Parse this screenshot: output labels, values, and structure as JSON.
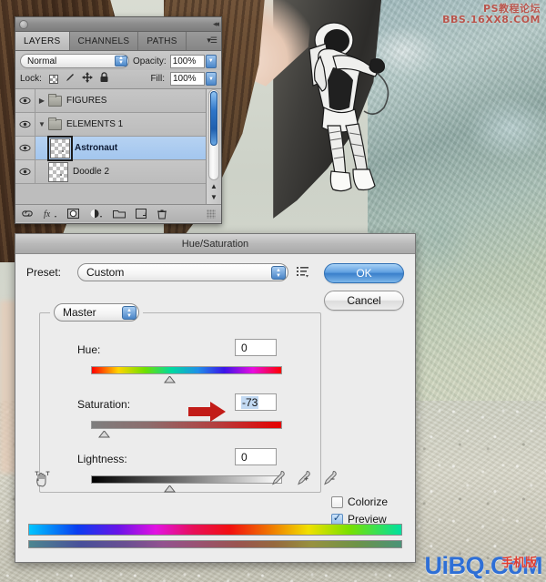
{
  "app": {
    "watermark_top_line1": "PS教程论坛",
    "watermark_top_line2": "BBS.16XX8.COM",
    "watermark_bottom": "UiBQ.CoM",
    "watermark_bottom_cn": "手机版"
  },
  "layers_panel": {
    "tabs": [
      {
        "label": "LAYERS",
        "active": true
      },
      {
        "label": "CHANNELS",
        "active": false
      },
      {
        "label": "PATHS",
        "active": false
      }
    ],
    "blend_mode": "Normal",
    "opacity_label": "Opacity:",
    "opacity_value": "100%",
    "lock_label": "Lock:",
    "fill_label": "Fill:",
    "fill_value": "100%",
    "layers": [
      {
        "name": "FIGURES",
        "type": "group",
        "expanded": false,
        "visible": true,
        "selected": false
      },
      {
        "name": "ELEMENTS 1",
        "type": "group",
        "expanded": true,
        "visible": true,
        "selected": false
      },
      {
        "name": "Astronaut",
        "type": "layer",
        "visible": true,
        "selected": true
      },
      {
        "name": "Doodle 2",
        "type": "layer",
        "visible": true,
        "selected": false
      }
    ],
    "footer_icons": [
      "link-layers-icon",
      "fx-icon",
      "layer-mask-icon",
      "adjustment-layer-icon",
      "new-group-icon",
      "new-layer-icon",
      "delete-layer-icon"
    ]
  },
  "dialog": {
    "title": "Hue/Saturation",
    "preset_label": "Preset:",
    "preset_value": "Custom",
    "preset_menu_icon": "preset-options-icon",
    "ok_label": "OK",
    "cancel_label": "Cancel",
    "channel_value": "Master",
    "sliders": [
      {
        "label": "Hue:",
        "value": "0",
        "thumb_percent": 50,
        "highlighted": false
      },
      {
        "label": "Saturation:",
        "value": "-73",
        "thumb_percent": 13.5,
        "highlighted": true
      },
      {
        "label": "Lightness:",
        "value": "0",
        "thumb_percent": 50,
        "highlighted": false
      }
    ],
    "colorize_label": "Colorize",
    "colorize_checked": false,
    "preview_label": "Preview",
    "preview_checked": true,
    "eyedropper_icons": [
      "eyedropper-icon",
      "eyedropper-add-icon",
      "eyedropper-subtract-icon"
    ],
    "hand_icon": "on-image-adjust-icon"
  }
}
